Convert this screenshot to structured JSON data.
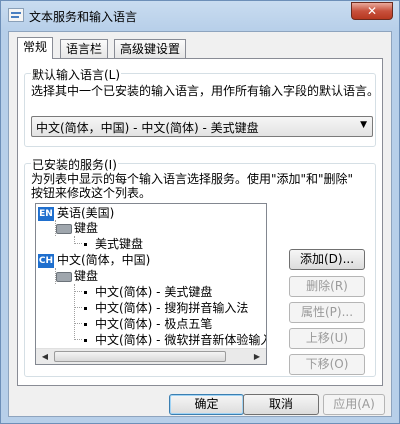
{
  "window": {
    "title": "文本服务和输入语言",
    "close": "✕"
  },
  "tabs": [
    "常规",
    "语言栏",
    "高级键设置"
  ],
  "default_lang": {
    "group_title": "默认输入语言(L)",
    "description": "选择其中一个已安装的输入语言，用作所有输入字段的默认语言。",
    "selected": "中文(简体，中国) - 中文(简体) - 美式键盘"
  },
  "services": {
    "group_title": "已安装的服务(I)",
    "description_line1": "为列表中显示的每个输入语言选择服务。使用\"添加\"和\"删除\"",
    "description_line2": "按钮来修改这个列表。",
    "tree": {
      "lang1": {
        "badge": "EN",
        "label": "英语(美国)",
        "keyboard": "键盘",
        "items": [
          "美式键盘"
        ]
      },
      "lang2": {
        "badge": "CH",
        "label": "中文(简体，中国)",
        "keyboard": "键盘",
        "items": [
          "中文(简体) - 美式键盘",
          "中文(简体) - 搜狗拼音输入法",
          "中文(简体) - 极点五笔",
          "中文(简体) - 微软拼音新体验输入风"
        ]
      }
    },
    "buttons": {
      "add": "添加(D)...",
      "remove": "删除(R)",
      "properties": "属性(P)...",
      "move_up": "上移(U)",
      "move_down": "下移(O)"
    }
  },
  "footer": {
    "ok": "确定",
    "cancel": "取消",
    "apply": "应用(A)"
  },
  "icons": {
    "scroll_left": "◀",
    "scroll_right": "▶",
    "combo_arrow": "▼"
  }
}
